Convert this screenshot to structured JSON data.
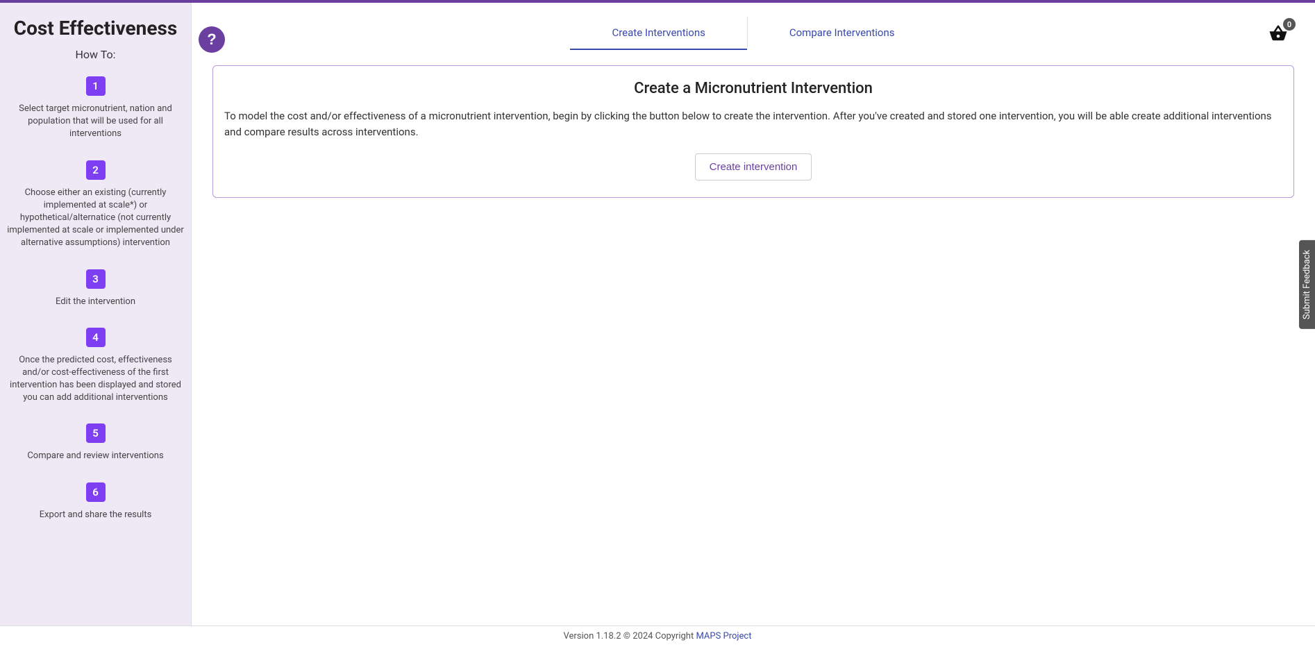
{
  "sidebar": {
    "title": "Cost Effectiveness",
    "howto_label": "How To:",
    "steps": [
      {
        "num": "1",
        "text": "Select target micronutrient, nation and population that will be used for all interventions"
      },
      {
        "num": "2",
        "text": "Choose either an existing (currently implemented at scale*) or hypothetical/alternatice (not currently implemented at scale or implemented under alternative assumptions) intervention"
      },
      {
        "num": "3",
        "text": "Edit the intervention"
      },
      {
        "num": "4",
        "text": "Once the predicted cost, effectiveness and/or cost-effectiveness of the first intervention has been displayed and stored you can add additional interventions"
      },
      {
        "num": "5",
        "text": "Compare and review interventions"
      },
      {
        "num": "6",
        "text": "Export and share the results"
      }
    ]
  },
  "help": {
    "symbol": "?"
  },
  "tabs": {
    "create": "Create Interventions",
    "compare": "Compare Interventions"
  },
  "basket": {
    "count": "0"
  },
  "card": {
    "title": "Create a Micronutrient Intervention",
    "text": "To model the cost and/or effectiveness of a micronutrient intervention, begin by clicking the button below to create the intervention. After you've created and stored one intervention, you will be able create additional interventions and compare results across interventions.",
    "button": "Create intervention"
  },
  "footer": {
    "prefix": "Version 1.18.2 © 2024 Copyright ",
    "link": "MAPS Project"
  },
  "feedback": {
    "label": "Submit Feedback"
  }
}
